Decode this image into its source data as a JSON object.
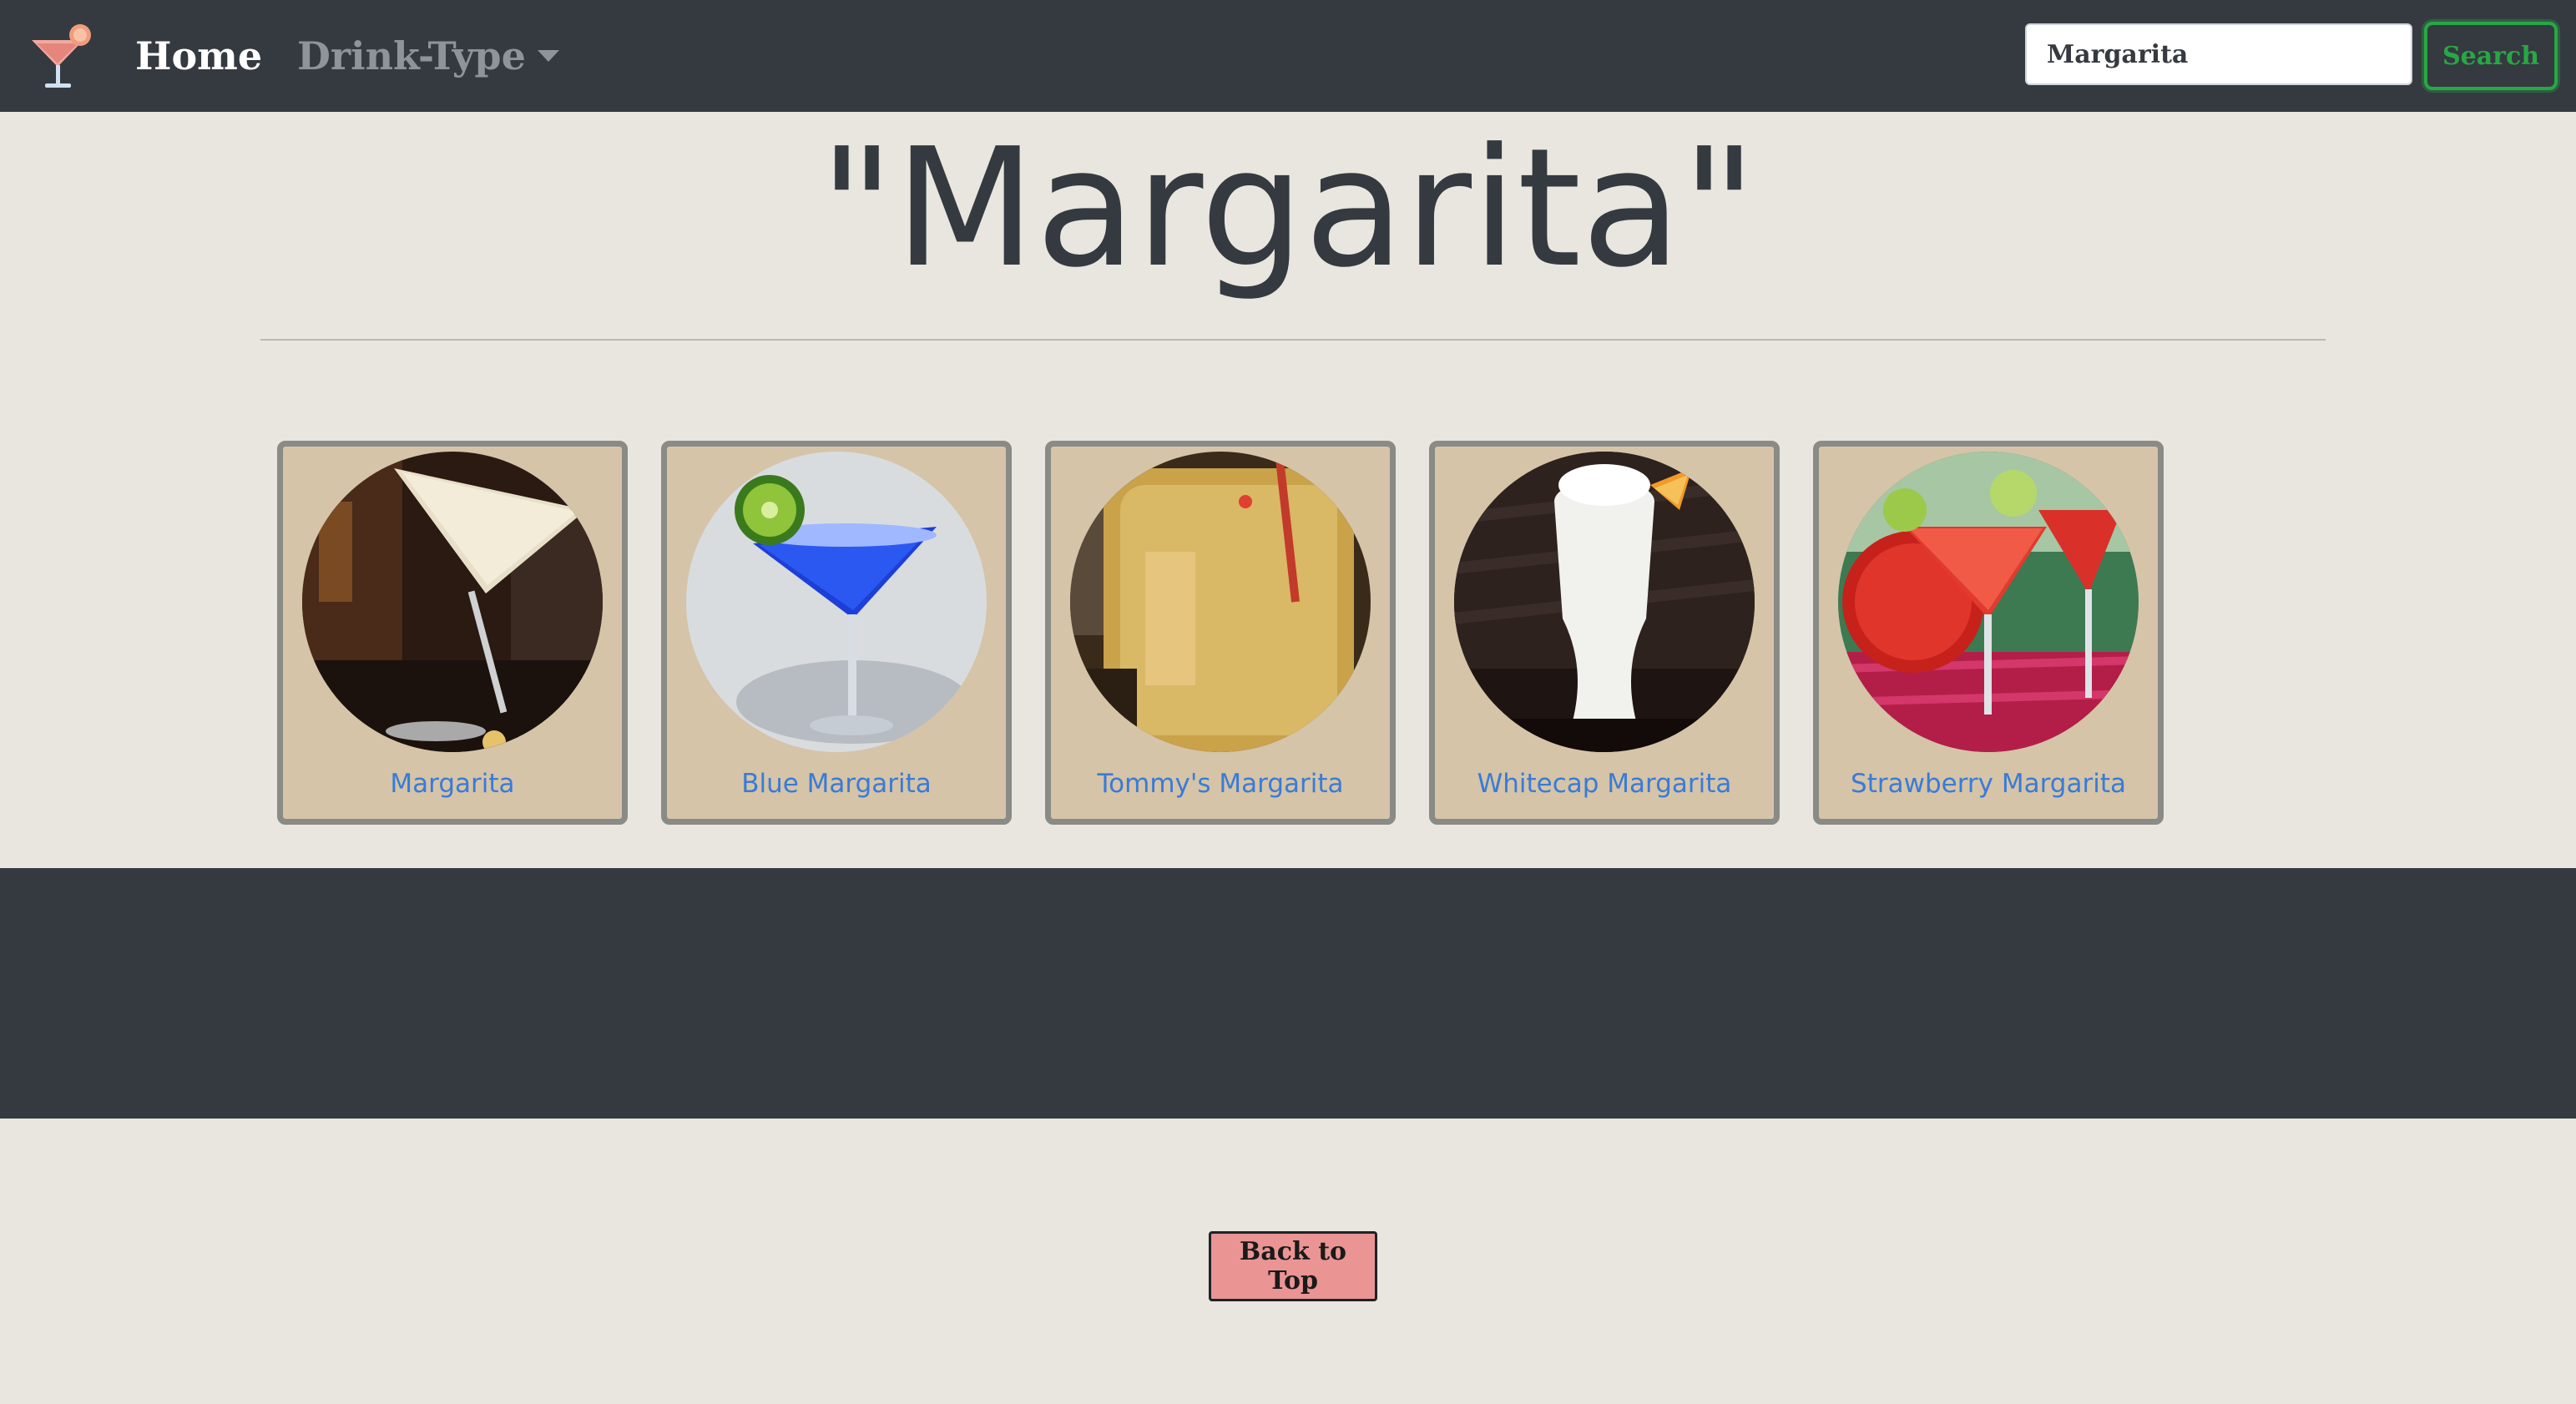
{
  "navbar": {
    "home_label": "Home",
    "drink_type_label": "Drink-Type",
    "search_value": "Margarita",
    "search_button": "Search"
  },
  "page": {
    "title": "\"Margarita\""
  },
  "drinks": [
    {
      "name": "Margarita"
    },
    {
      "name": "Blue Margarita"
    },
    {
      "name": "Tommy's Margarita"
    },
    {
      "name": "Whitecap Margarita"
    },
    {
      "name": "Strawberry Margarita"
    }
  ],
  "footer": {
    "back_to_top": "Back to Top"
  },
  "colors": {
    "navbar": "#343a40",
    "page_bg": "#e8e6de",
    "card_bg": "#d5c4a8",
    "link": "#3a7bd5",
    "search_accent": "#28a745",
    "back_button": "#ea9494"
  },
  "icons": [
    "cocktail-logo-icon",
    "caret-down-icon"
  ]
}
